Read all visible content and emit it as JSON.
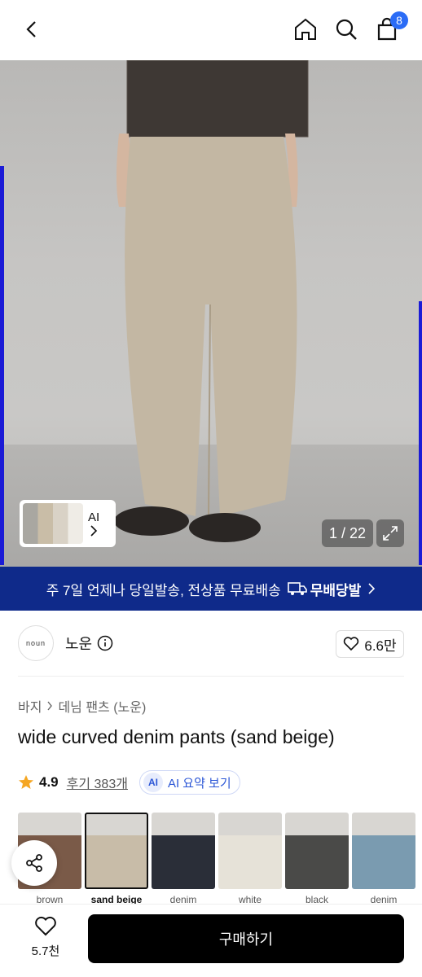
{
  "header": {
    "cart_count": "8"
  },
  "gallery": {
    "ai_label": "AI",
    "counter": "1 / 22"
  },
  "banner": {
    "text": "주 7일 언제나 당일발송, 전상품 무료배송",
    "logo_text": "무배당발"
  },
  "brand": {
    "logo_text": "noun",
    "name": "노운",
    "likes": "6.6만"
  },
  "breadcrumb": {
    "level1": "바지",
    "level2": "데님 팬츠 (노운)"
  },
  "product": {
    "title": "wide curved denim pants (sand beige)",
    "rating": "4.9",
    "reviews": "후기 383개",
    "ai_summary": "AI 요약 보기",
    "ai_badge": "AI"
  },
  "variants": [
    {
      "label": "brown",
      "color": "#7a5a48"
    },
    {
      "label": "sand beige",
      "color": "#c8bca8"
    },
    {
      "label": "denim",
      "color": "#2a2e38"
    },
    {
      "label": "white",
      "color": "#e6e2d8"
    },
    {
      "label": "black",
      "color": "#4a4a48"
    },
    {
      "label": "denim",
      "color": "#7a9bb0"
    }
  ],
  "bottom": {
    "wish_count": "5.7천",
    "buy_label": "구매하기"
  }
}
